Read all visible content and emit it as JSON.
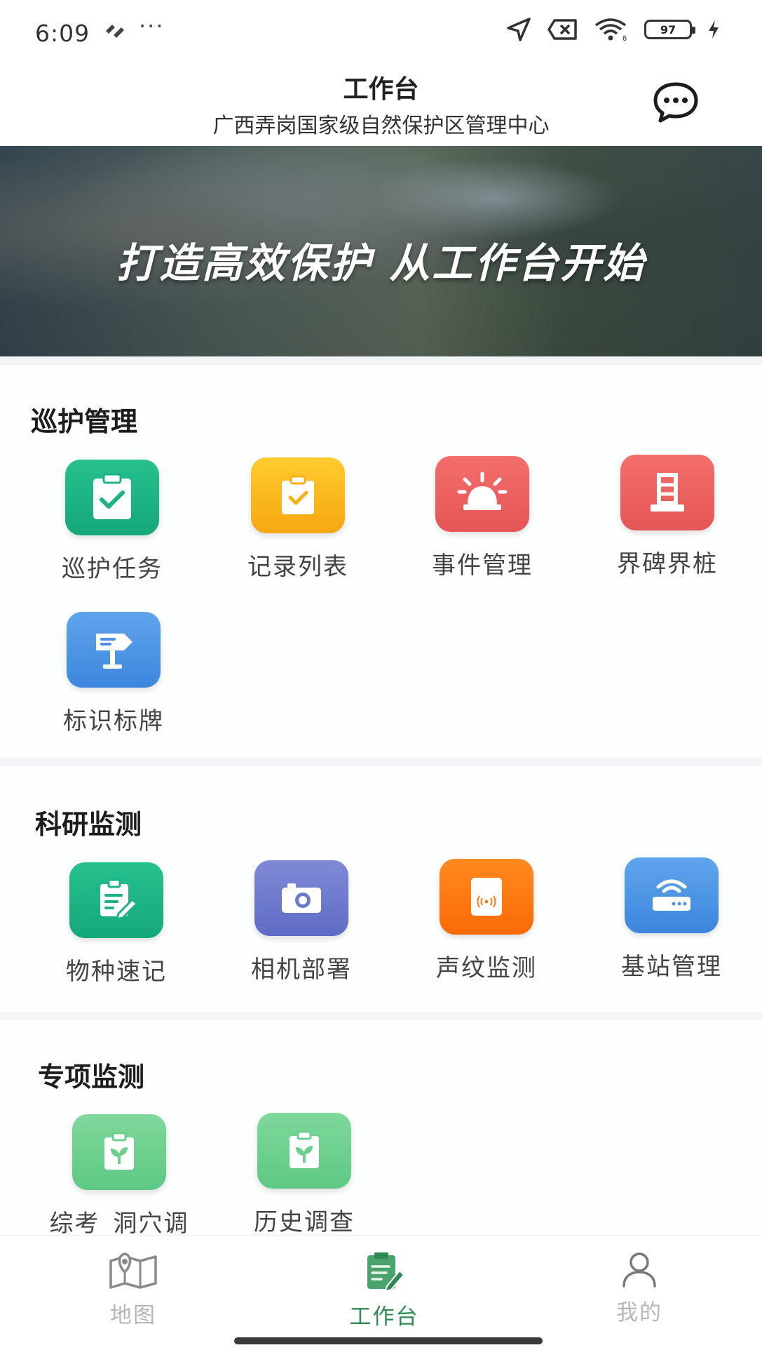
{
  "status_bar": {
    "time": "6:09",
    "dots": "···",
    "battery": "97"
  },
  "header": {
    "title": "工作台",
    "subtitle": "广西弄岗国家级自然保护区管理中心"
  },
  "banner": {
    "slogan": "打造高效保护 从工作台开始"
  },
  "sections": [
    {
      "title": "巡护管理",
      "items": [
        {
          "label": "巡护任务",
          "icon": "clipboard-check-icon",
          "color": "#1bb383"
        },
        {
          "label": "记录列表",
          "icon": "clipboard-list-icon",
          "color": "#f9b81d"
        },
        {
          "label": "事件管理",
          "icon": "alarm-light-icon",
          "color": "#ec6262"
        },
        {
          "label": "界碑界桩",
          "icon": "boundary-marker-icon",
          "color": "#ec6262"
        },
        {
          "label": "标识标牌",
          "icon": "signpost-icon",
          "color": "#4b92e4"
        }
      ]
    },
    {
      "title": "科研监测",
      "items": [
        {
          "label": "物种速记",
          "icon": "note-edit-icon",
          "color": "#1bb383"
        },
        {
          "label": "相机部署",
          "icon": "camera-icon",
          "color": "#6c78cc"
        },
        {
          "label": "声纹监测",
          "icon": "sound-sensor-icon",
          "color": "#fb7a12"
        },
        {
          "label": "基站管理",
          "icon": "router-icon",
          "color": "#4b92e4"
        }
      ]
    },
    {
      "title": "专项监测",
      "items": [
        {
          "label": "综考_洞穴调",
          "icon": "plant-survey-icon",
          "color": "#6ccf8f"
        },
        {
          "label": "历史调查",
          "icon": "plant-survey-icon",
          "color": "#6ccf8f"
        }
      ]
    }
  ],
  "bottom_nav": [
    {
      "label": "地图",
      "icon": "map-icon",
      "active": false
    },
    {
      "label": "工作台",
      "icon": "workbench-icon",
      "active": true
    },
    {
      "label": "我的",
      "icon": "user-icon",
      "active": false
    }
  ],
  "colors": {
    "accent": "#2f8a55",
    "inactive": "#b7b7b7"
  }
}
